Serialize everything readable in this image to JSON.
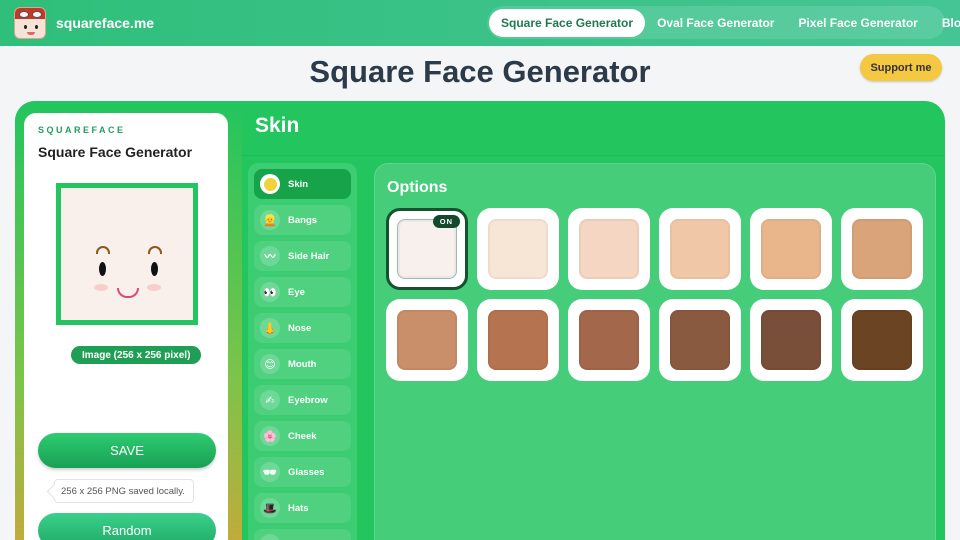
{
  "header": {
    "brand": "squareface.me",
    "nav": [
      {
        "label": "Square Face Generator",
        "active": true
      },
      {
        "label": "Oval Face Generator",
        "active": false
      },
      {
        "label": "Pixel Face Generator",
        "active": false
      },
      {
        "label": "Blog",
        "active": false
      }
    ]
  },
  "page": {
    "title": "Square Face Generator",
    "support_label": "Support me"
  },
  "preview": {
    "brand": "SQUAREFACE",
    "title": "Square Face Generator",
    "image_badge": "Image (256 x 256 pixel)",
    "save_label": "SAVE",
    "saved_note": "256 x 256 PNG saved locally.",
    "random_label": "Random"
  },
  "section": {
    "title": "Skin",
    "options_title": "Options",
    "selected_badge": "ON"
  },
  "categories": [
    {
      "label": "Skin",
      "icon": "skin-dot-icon",
      "active": true
    },
    {
      "label": "Bangs",
      "icon": "bangs-icon"
    },
    {
      "label": "Side Hair",
      "icon": "side-hair-icon"
    },
    {
      "label": "Eye",
      "icon": "eyes-icon"
    },
    {
      "label": "Nose",
      "icon": "nose-icon"
    },
    {
      "label": "Mouth",
      "icon": "mouth-icon"
    },
    {
      "label": "Eyebrow",
      "icon": "eyebrow-icon"
    },
    {
      "label": "Cheek",
      "icon": "cheek-icon"
    },
    {
      "label": "Glasses",
      "icon": "glasses-icon"
    },
    {
      "label": "Hats",
      "icon": "hat-icon"
    }
  ],
  "skin_colors": [
    "#f8f0ec",
    "#f7e5d6",
    "#f4d6c2",
    "#f0c8a8",
    "#e8b68a",
    "#d9a47a",
    "#c98e6a",
    "#b5744f",
    "#a3684c",
    "#8a5a40",
    "#7a4f3a",
    "#6b4423"
  ],
  "selected_skin_index": 0,
  "colors": {
    "accent": "#22c55e",
    "header": "#2fbf7a",
    "support": "#f5c842"
  }
}
